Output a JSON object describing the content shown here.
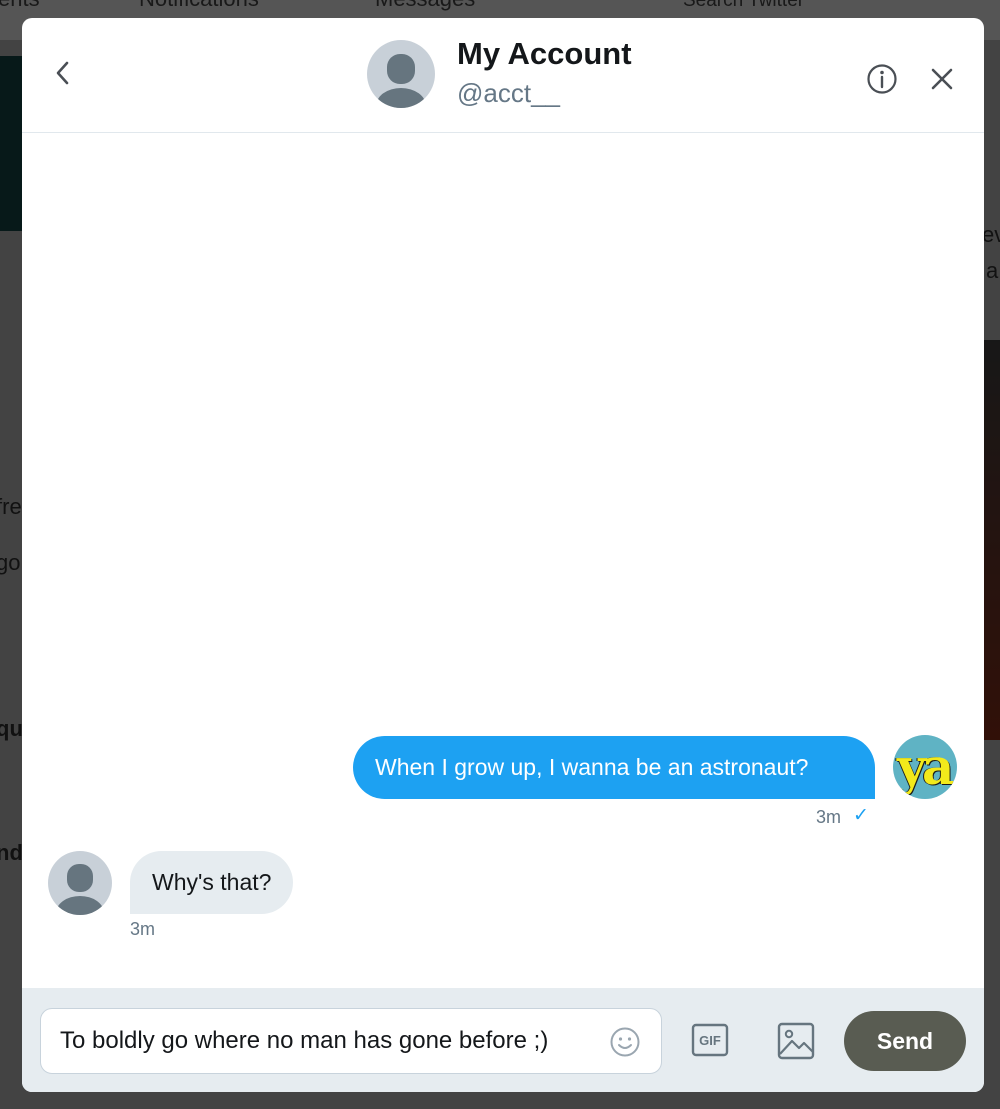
{
  "background": {
    "nav": [
      "ents",
      "Notifications",
      "Messages",
      "Search Twitter"
    ],
    "fragments": [
      "ev",
      "a",
      "fre",
      "go",
      "qu",
      "nd"
    ]
  },
  "header": {
    "name": "My Account",
    "handle": "@acct__"
  },
  "messages": [
    {
      "direction": "outgoing",
      "text": "When I grow up, I wanna be an astronaut?",
      "time": "3m",
      "status": "✓"
    },
    {
      "direction": "incoming",
      "text": "Why's that?",
      "time": "3m"
    }
  ],
  "my_avatar": {
    "logo_text": "ya"
  },
  "composer": {
    "value": "To boldly go where no man has gone before ;)",
    "send_label": "Send"
  },
  "icons": [
    "back-arrow-icon",
    "info-icon",
    "close-icon",
    "emoji-icon",
    "gif-icon",
    "image-icon",
    "default-avatar-icon"
  ],
  "colors": {
    "accent": "#1da1f2",
    "bubble_incoming": "#e6ecf0",
    "send_button": "#595c52",
    "composer_bg": "#e6ecf0"
  }
}
